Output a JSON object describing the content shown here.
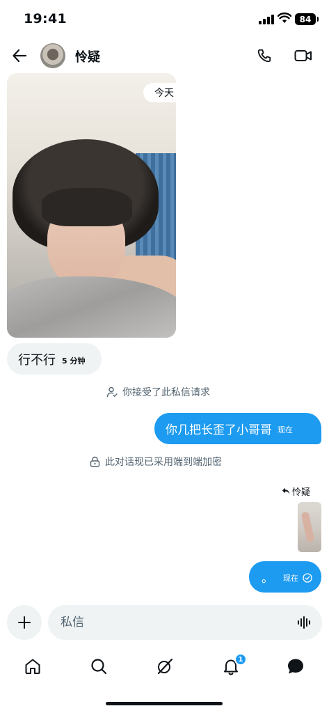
{
  "status_bar": {
    "time": "19:41",
    "battery": "84",
    "icons": [
      "cellular-signal-icon",
      "wifi-icon",
      "battery-icon"
    ]
  },
  "header": {
    "contact_name": "怜疑",
    "icons": [
      "back-arrow-icon",
      "phone-icon",
      "video-camera-icon"
    ]
  },
  "conversation": {
    "date_separator": "今天",
    "received_message": {
      "text": "行不行",
      "time": "5 分钟"
    },
    "notice_accepted": "你接受了此私信请求",
    "sent_message_1": {
      "text": "你几把长歪了小哥哥",
      "time": "现在"
    },
    "notice_encrypted": "此对话现已采用端到端加密",
    "reply_label": "怜疑",
    "sent_message_2": {
      "text": "。",
      "time": "现在"
    }
  },
  "composer": {
    "placeholder": "私信",
    "icons": [
      "plus-icon",
      "voice-waveform-icon"
    ]
  },
  "tab_bar": {
    "notification_badge": "1",
    "tabs": [
      "home",
      "search",
      "grok",
      "notifications",
      "messages"
    ]
  },
  "colors": {
    "accent": "#1d9bf0",
    "bubble_received": "#eff3f4",
    "text_primary": "#0f1419",
    "text_secondary": "#536471"
  }
}
